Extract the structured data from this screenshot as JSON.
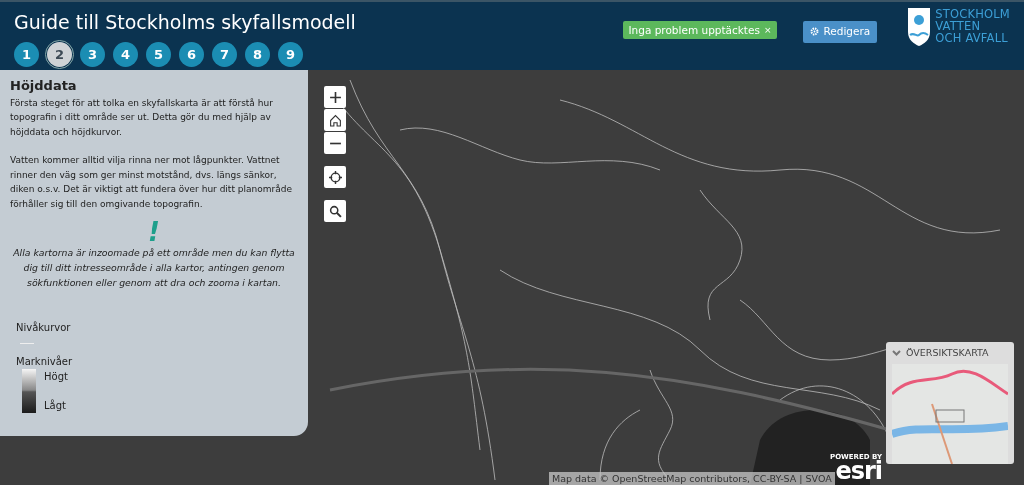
{
  "header": {
    "title": "Guide till Stockholms skyfallsmodell",
    "steps": [
      {
        "label": "1",
        "selected": false
      },
      {
        "label": "2",
        "selected": true
      },
      {
        "label": "3",
        "selected": false
      },
      {
        "label": "4",
        "selected": false
      },
      {
        "label": "5",
        "selected": false
      },
      {
        "label": "6",
        "selected": false
      },
      {
        "label": "7",
        "selected": false
      },
      {
        "label": "8",
        "selected": false
      },
      {
        "label": "9",
        "selected": false
      }
    ],
    "status_badge": {
      "text": "Inga problem upptäcktes",
      "close": "×"
    },
    "edit_button": "Redigera",
    "logo_lines": [
      "STOCKHOLM",
      "VATTEN",
      "OCH AVFALL"
    ]
  },
  "panel": {
    "heading": "Höjddata",
    "paragraphs": [
      "Första steget för att tolka en skyfallskarta är att förstå hur topografin i ditt område ser ut. Detta gör du med hjälp av höjddata och höjdkurvor.",
      "Vatten kommer alltid vilja rinna ner mot lågpunkter. Vattnet rinner den väg som ger minst motstånd, dvs. längs sänkor, diken o.s.v. Det är viktigt att fundera över hur ditt planområde förhåller sig till den omgivande topografin."
    ],
    "notice_mark": "!",
    "notice": "Alla kartorna är inzoomade på ett område men du kan flytta dig till ditt intresseområde i alla kartor, antingen genom sökfunktionen eller genom att dra och zooma i kartan.",
    "legend": {
      "contours_label": "Nivåkurvor",
      "levels_label": "Marknivåer",
      "high": "Högt",
      "low": "Lågt"
    }
  },
  "map": {
    "controls": [
      {
        "kind": "zoom-in"
      },
      {
        "kind": "home"
      },
      {
        "kind": "zoom-out"
      },
      {
        "kind": "locate"
      },
      {
        "kind": "search"
      }
    ],
    "attribution": "Map data © OpenStreetMap contributors, CC-BY-SA | SVOA",
    "esri": {
      "powered_by": "POWERED BY",
      "wordmark": "esri"
    },
    "overview": {
      "title": "ÖVERSIKTSKARTA",
      "expanded": true
    }
  }
}
